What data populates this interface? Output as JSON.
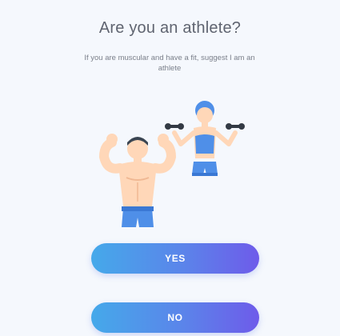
{
  "question": {
    "title": "Are you an athlete?",
    "subtitle": "If you are muscular and have a fit, suggest I am an athlete"
  },
  "illustration": {
    "icon": "athletes-illustration",
    "figures": [
      "muscular-man",
      "woman-with-dumbbells"
    ]
  },
  "buttons": {
    "yes_label": "YES",
    "no_label": "NO"
  },
  "colors": {
    "background": "#f5f8fd",
    "button_gradient_start": "#45a9ea",
    "button_gradient_end": "#6e5bea",
    "athlete_blue": "#4f8fe8",
    "skin": "#ffd7b8"
  }
}
